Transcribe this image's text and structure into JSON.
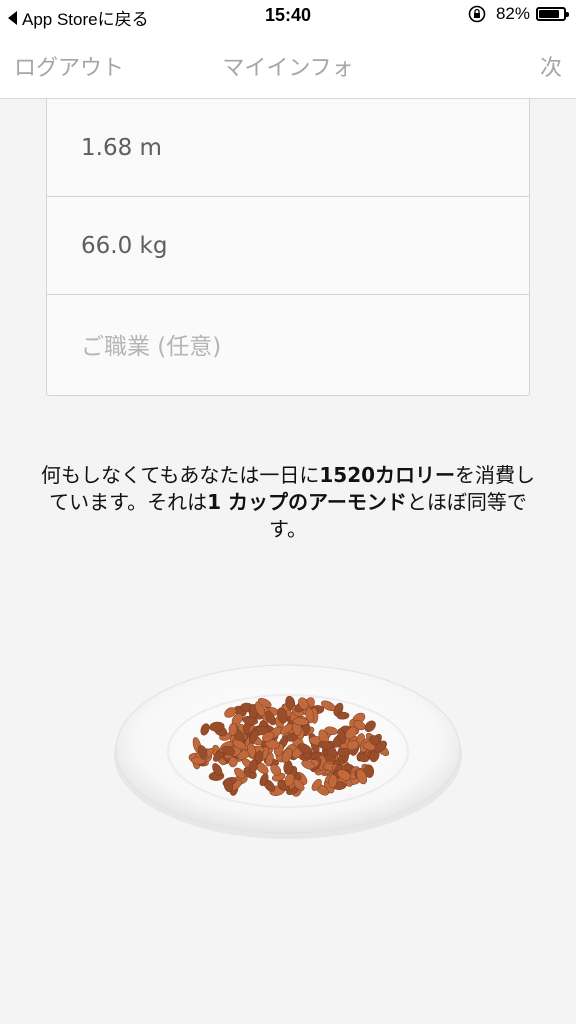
{
  "status_bar": {
    "back_label": "App Storeに戻る",
    "time": "15:40",
    "battery": "82%",
    "battery_level": 0.82
  },
  "nav": {
    "left": "ログアウト",
    "title": "マイインフォ",
    "right": "次"
  },
  "form": {
    "height_value": "1.68 m",
    "weight_value": "66.0 kg",
    "occupation_placeholder": "ご職業 (任意)"
  },
  "info": {
    "part1": "何もしなくてもあなたは一日に",
    "calories": "1520カロリー",
    "part2": "を消費しています。それは",
    "equivalent": "1 カップのアーモンド",
    "part3": "とほぼ同等です。"
  },
  "colors": {
    "almond": "#c0693c",
    "almond_dark": "#9a4d2a",
    "plate": "#ffffff",
    "background": "#f4f4f4"
  }
}
